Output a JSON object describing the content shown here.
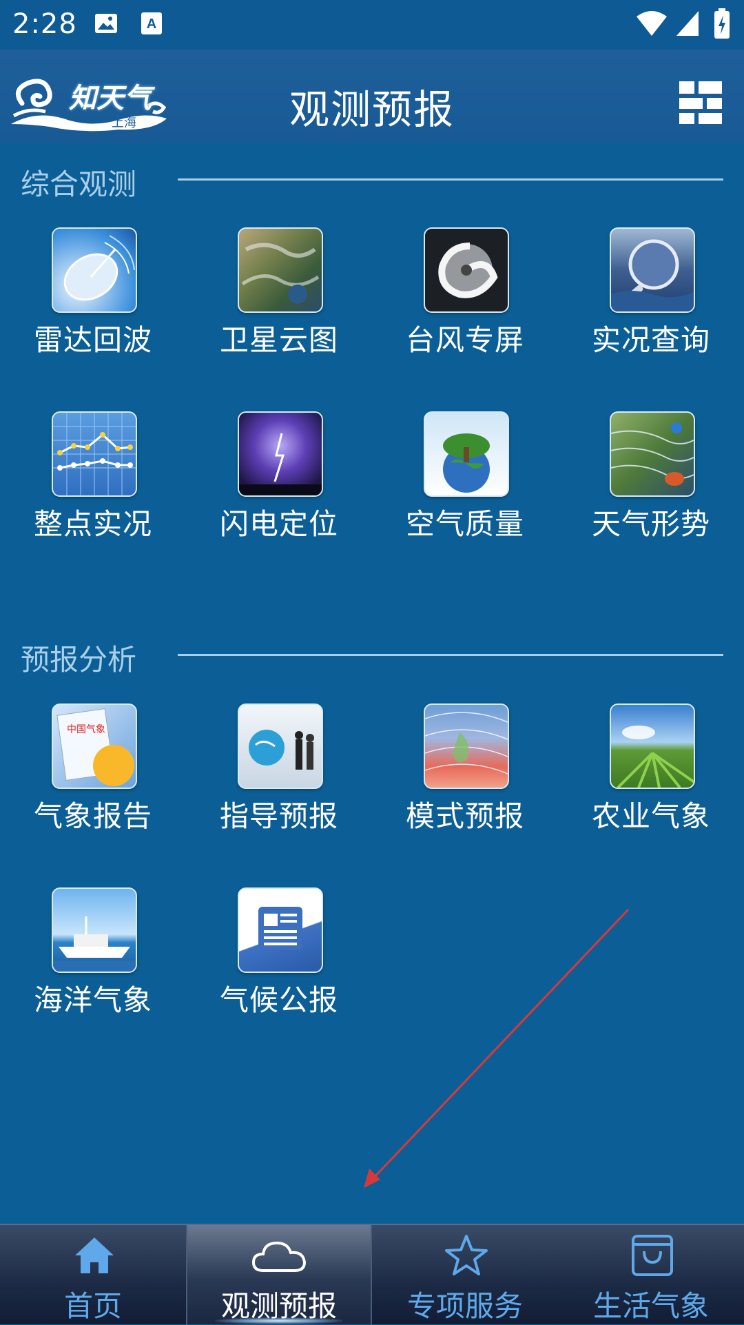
{
  "status_bar": {
    "time": "2:28"
  },
  "app_bar": {
    "title": "观测预报",
    "logo_text": "知天气",
    "logo_sub": "上海"
  },
  "sections": [
    {
      "title": "综合观测",
      "items": [
        {
          "label": "雷达回波",
          "icon": "radar-dish-icon"
        },
        {
          "label": "卫星云图",
          "icon": "satellite-map-icon"
        },
        {
          "label": "台风专屏",
          "icon": "typhoon-icon"
        },
        {
          "label": "实况查询",
          "icon": "magnifier-icon"
        },
        {
          "label": "整点实况",
          "icon": "line-chart-icon"
        },
        {
          "label": "闪电定位",
          "icon": "lightning-icon"
        },
        {
          "label": "空气质量",
          "icon": "earth-tree-icon"
        },
        {
          "label": "天气形势",
          "icon": "weather-map-icon"
        }
      ]
    },
    {
      "title": "预报分析",
      "items": [
        {
          "label": "气象报告",
          "icon": "report-icon"
        },
        {
          "label": "指导预报",
          "icon": "globe-people-icon"
        },
        {
          "label": "模式预报",
          "icon": "model-map-icon"
        },
        {
          "label": "农业气象",
          "icon": "farm-field-icon"
        },
        {
          "label": "海洋气象",
          "icon": "ship-icon"
        },
        {
          "label": "气候公报",
          "icon": "bulletin-icon"
        }
      ]
    }
  ],
  "bottom_nav": [
    {
      "label": "首页",
      "icon": "home-icon",
      "active": false
    },
    {
      "label": "观测预报",
      "icon": "cloud-icon",
      "active": true
    },
    {
      "label": "专项服务",
      "icon": "star-icon",
      "active": false
    },
    {
      "label": "生活气象",
      "icon": "shopping-bag-icon",
      "active": false
    }
  ],
  "colors": {
    "background": "#0b5f96",
    "section_title": "#a9cfea",
    "nav_inactive": "#5fa9ea",
    "annotation_arrow": "#d9383a"
  }
}
